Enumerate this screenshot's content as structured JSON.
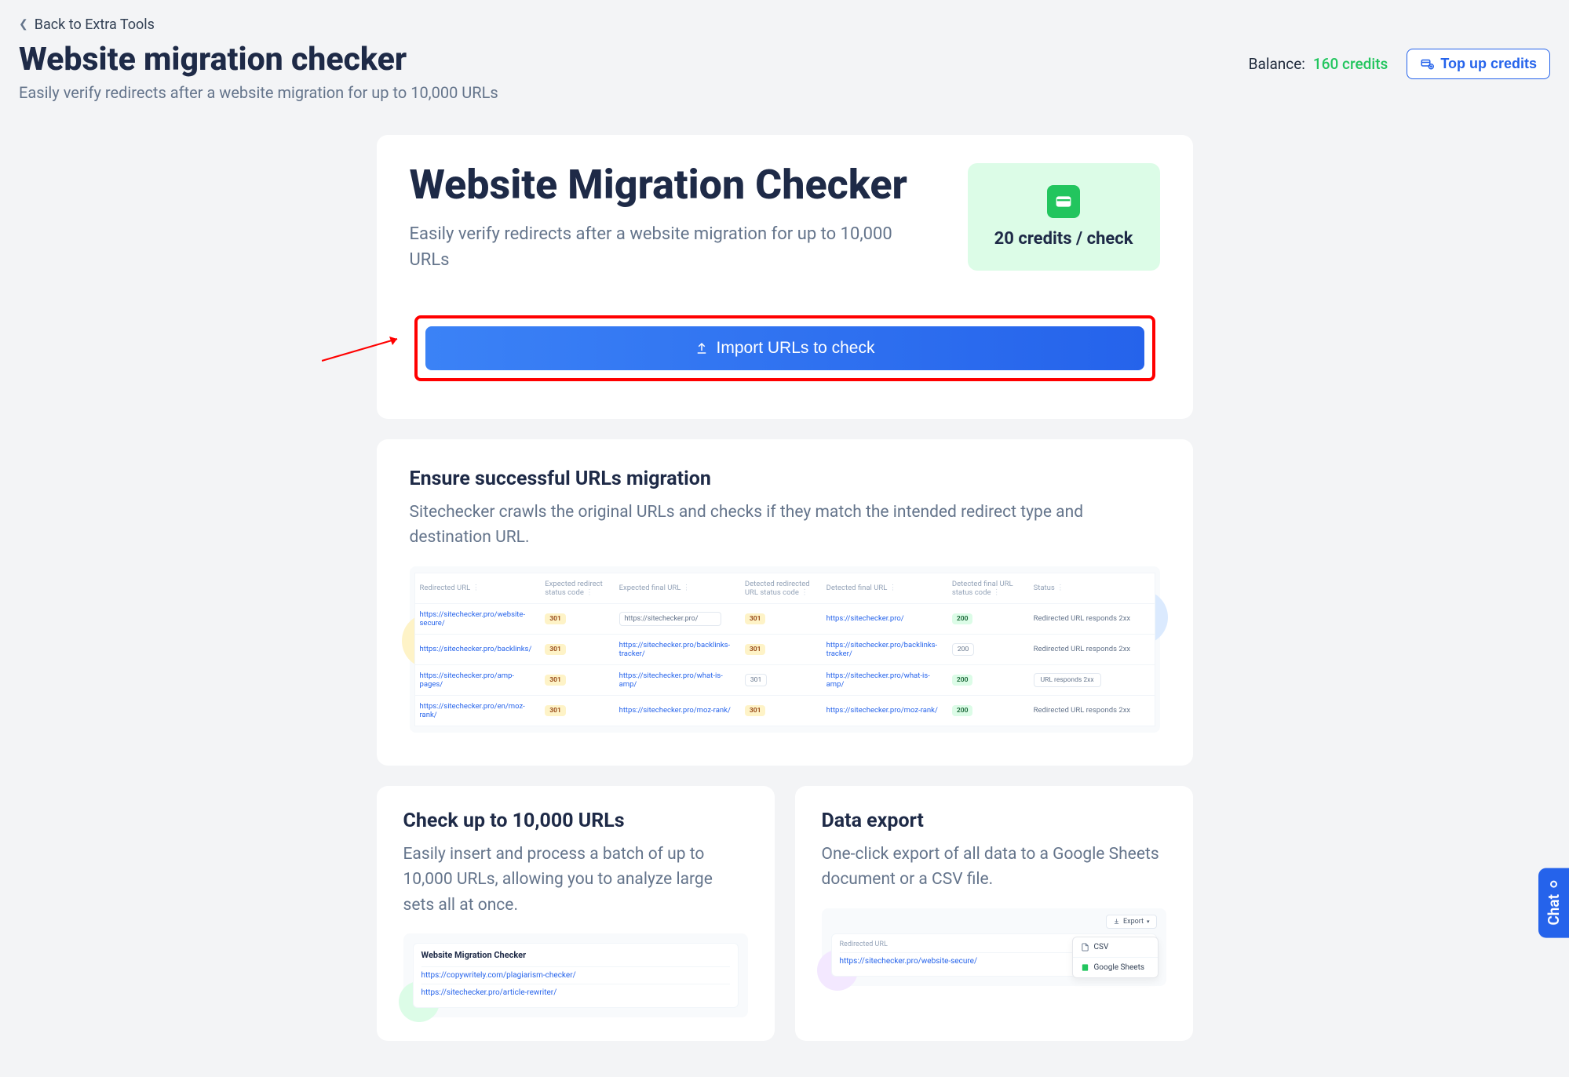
{
  "back_link": "Back to Extra Tools",
  "page_title": "Website migration checker",
  "page_subtitle": "Easily verify redirects after a website migration for up to 10,000 URLs",
  "balance_label": "Balance:",
  "balance_credits": "160 credits",
  "topup_label": "Top up credits",
  "hero_title": "Website Migration Checker",
  "hero_sub": "Easily verify redirects after a website migration for up to 10,000 URLs",
  "credits_per_check": "20 credits / check",
  "import_button": "Import URLs to check",
  "section1_title": "Ensure successful URLs migration",
  "section1_text": "Sitechecker crawls the original URLs and checks if they match the intended redirect type and destination URL.",
  "preview_search": "https://sitechecker.pro/",
  "preview_headers": [
    "Redirected URL",
    "Expected redirect status code",
    "Expected final URL",
    "Detected redirected URL status code",
    "Detected final URL",
    "Detected final URL status code",
    "Status"
  ],
  "preview_rows": [
    {
      "url": "https://sitechecker.pro/website-secure/",
      "er": "301",
      "ef": "",
      "dr": "301",
      "df": "https://sitechecker.pro/",
      "dfc": "200",
      "status": "Redirected URL responds 2xx",
      "green": false
    },
    {
      "url": "https://sitechecker.pro/backlinks/",
      "er": "301",
      "ef": "https://sitechecker.pro/backlinks-tracker/",
      "dr": "301",
      "df": "https://sitechecker.pro/backlinks-tracker/",
      "dfc": "200",
      "status": "Redirected URL responds 2xx",
      "green": false,
      "dfcbox": true
    },
    {
      "url": "https://sitechecker.pro/amp-pages/",
      "er": "301",
      "ef": "https://sitechecker.pro/what-is-amp/",
      "dr": "301",
      "df": "https://sitechecker.pro/what-is-amp/",
      "dfc": "200",
      "status": "URL responds 2xx",
      "green": true,
      "box": true,
      "drbox": true
    },
    {
      "url": "https://sitechecker.pro/en/moz-rank/",
      "er": "301",
      "ef": "https://sitechecker.pro/moz-rank/",
      "dr": "301",
      "df": "https://sitechecker.pro/moz-rank/",
      "dfc": "200",
      "status": "Redirected URL responds 2xx",
      "green": true
    }
  ],
  "card_a_title": "Check up to 10,000 URLs",
  "card_a_text": "Easily insert and process a batch of up to 10,000 URLs, allowing you to analyze large sets all at once.",
  "card_a_mini_title": "Website Migration Checker",
  "card_a_mini_rows": [
    "https://copywritely.com/plagiarism-checker/",
    "https://sitechecker.pro/article-rewriter/"
  ],
  "card_b_title": "Data export",
  "card_b_text": "One-click export of all data to a Google Sheets document or a CSV file.",
  "card_b_export_label": "Export",
  "card_b_menu_csv": "CSV",
  "card_b_menu_sheets": "Google Sheets",
  "card_b_col_header": "Redirected URL",
  "card_b_row": "https://sitechecker.pro/website-secure/",
  "chat_label": "Chat"
}
